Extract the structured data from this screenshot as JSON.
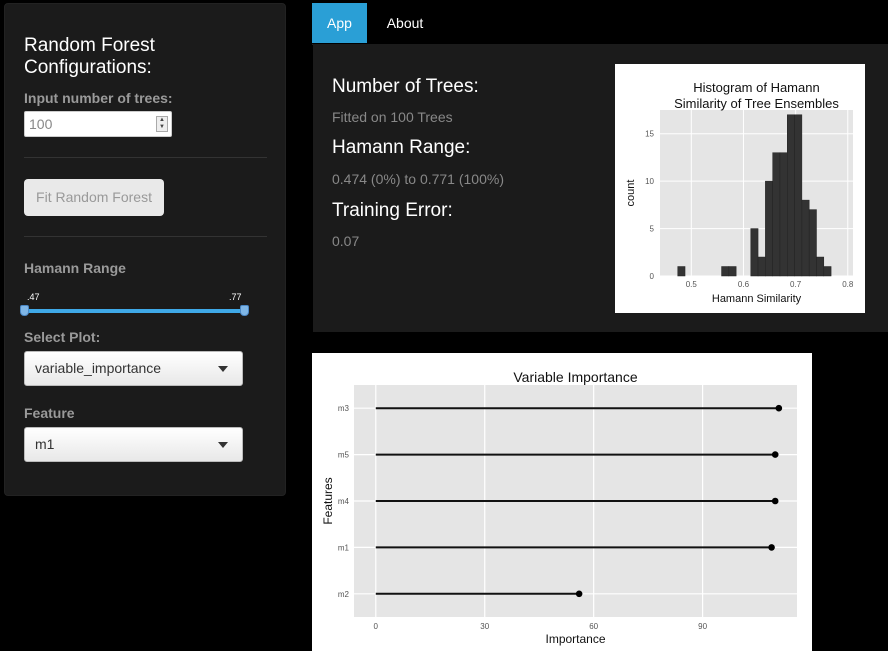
{
  "sidebar": {
    "title": "Random Forest Configurations:",
    "trees_label": "Input number of trees:",
    "trees_value": "100",
    "fit_button": "Fit Random Forest",
    "hamann_label": "Hamann Range",
    "slider_min_label": ".47",
    "slider_max_label": ".77",
    "slider_low": 0.0,
    "slider_high": 1.0,
    "select_plot_label": "Select Plot:",
    "select_plot_value": "variable_importance",
    "feature_label": "Feature",
    "feature_value": "m1"
  },
  "tabs": [
    {
      "label": "App",
      "active": true
    },
    {
      "label": "About",
      "active": false
    }
  ],
  "info": {
    "trees_heading": "Number of Trees:",
    "trees_text": "Fitted on 100 Trees",
    "hamann_heading": "Hamann Range:",
    "hamann_text": "0.474 (0%) to 0.771 (100%)",
    "error_heading": "Training Error:",
    "error_text": "0.07"
  },
  "colors": {
    "accent": "#2a9fd6",
    "panel": "#1b1b1b",
    "plot_bg": "#e5e5e5"
  },
  "chart_data": [
    {
      "type": "bar",
      "title": "Histogram of Hamann Similarity of Tree Ensembles",
      "xlabel": "Hamann Similarity",
      "ylabel": "count",
      "xlim": [
        0.44,
        0.81
      ],
      "ylim": [
        0,
        17.5
      ],
      "xticks": [
        "0.5",
        "0.6",
        "0.7",
        "0.8"
      ],
      "yticks": [
        "0",
        "5",
        "10",
        "15"
      ],
      "bins": [
        {
          "x0": 0.46,
          "x1": 0.474,
          "count": 0
        },
        {
          "x0": 0.474,
          "x1": 0.488,
          "count": 1
        },
        {
          "x0": 0.488,
          "x1": 0.502,
          "count": 0
        },
        {
          "x0": 0.502,
          "x1": 0.516,
          "count": 0
        },
        {
          "x0": 0.516,
          "x1": 0.53,
          "count": 0
        },
        {
          "x0": 0.53,
          "x1": 0.544,
          "count": 0
        },
        {
          "x0": 0.544,
          "x1": 0.558,
          "count": 0
        },
        {
          "x0": 0.558,
          "x1": 0.572,
          "count": 1
        },
        {
          "x0": 0.572,
          "x1": 0.586,
          "count": 1
        },
        {
          "x0": 0.586,
          "x1": 0.6,
          "count": 0
        },
        {
          "x0": 0.6,
          "x1": 0.614,
          "count": 0
        },
        {
          "x0": 0.614,
          "x1": 0.628,
          "count": 5
        },
        {
          "x0": 0.628,
          "x1": 0.642,
          "count": 2
        },
        {
          "x0": 0.642,
          "x1": 0.656,
          "count": 10
        },
        {
          "x0": 0.656,
          "x1": 0.67,
          "count": 13
        },
        {
          "x0": 0.67,
          "x1": 0.684,
          "count": 13
        },
        {
          "x0": 0.684,
          "x1": 0.698,
          "count": 17
        },
        {
          "x0": 0.698,
          "x1": 0.712,
          "count": 17
        },
        {
          "x0": 0.712,
          "x1": 0.726,
          "count": 8
        },
        {
          "x0": 0.726,
          "x1": 0.74,
          "count": 7
        },
        {
          "x0": 0.74,
          "x1": 0.754,
          "count": 2
        },
        {
          "x0": 0.754,
          "x1": 0.768,
          "count": 1
        },
        {
          "x0": 0.768,
          "x1": 0.782,
          "count": 0
        }
      ]
    },
    {
      "type": "scatter",
      "title": "Variable Importance",
      "xlabel": "Importance",
      "ylabel": "Features",
      "xlim": [
        -6,
        116
      ],
      "xticks": [
        0,
        30,
        60,
        90
      ],
      "categories": [
        "m3",
        "m5",
        "m4",
        "m1",
        "m2"
      ],
      "values": [
        111,
        110,
        110,
        109,
        56
      ]
    }
  ]
}
